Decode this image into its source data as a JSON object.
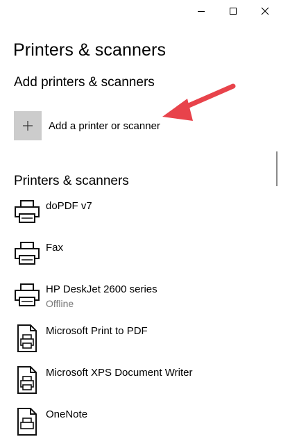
{
  "window": {
    "controls": [
      "minimize-icon",
      "maximize-icon",
      "close-icon"
    ]
  },
  "page": {
    "title": "Printers & scanners"
  },
  "add_section": {
    "heading": "Add printers & scanners",
    "add_button_label": "Add a printer or scanner",
    "add_icon": "plus-icon",
    "annotation_arrow_color": "#e8434b"
  },
  "devices_section": {
    "heading": "Printers & scanners",
    "items": [
      {
        "name": "doPDF v7",
        "status": "",
        "icon": "printer-icon"
      },
      {
        "name": "Fax",
        "status": "",
        "icon": "printer-icon"
      },
      {
        "name": "HP DeskJet 2600 series",
        "status": "Offline",
        "icon": "printer-icon"
      },
      {
        "name": "Microsoft Print to PDF",
        "status": "",
        "icon": "document-printer-icon"
      },
      {
        "name": "Microsoft XPS Document Writer",
        "status": "",
        "icon": "document-printer-icon"
      },
      {
        "name": "OneNote",
        "status": "",
        "icon": "document-printer-icon"
      }
    ]
  }
}
